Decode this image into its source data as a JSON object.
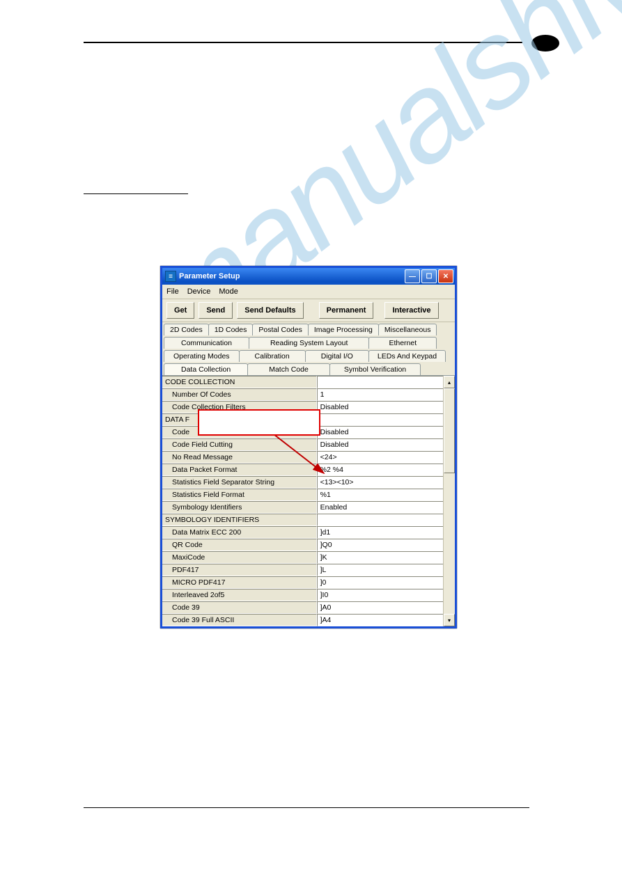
{
  "window": {
    "title": "Parameter Setup",
    "icon_glyph": "≡"
  },
  "menubar": {
    "file": "File",
    "device": "Device",
    "mode": "Mode"
  },
  "toolbar": {
    "get": "Get",
    "send": "Send",
    "send_defaults": "Send Defaults",
    "permanent": "Permanent",
    "interactive": "Interactive"
  },
  "tabs_row1": [
    "2D Codes",
    "1D Codes",
    "Postal Codes",
    "Image Processing",
    "Miscellaneous"
  ],
  "tabs_row2": [
    "Communication",
    "Reading System Layout",
    "Ethernet"
  ],
  "tabs_row3": [
    "Operating Modes",
    "Calibration",
    "Digital I/O",
    "LEDs And Keypad"
  ],
  "tabs_row4": [
    "Data Collection",
    "Match Code",
    "Symbol Verification"
  ],
  "grid": [
    {
      "kind": "header",
      "label": "CODE COLLECTION",
      "value": ""
    },
    {
      "kind": "row",
      "label": "Number Of Codes",
      "value": "1"
    },
    {
      "kind": "row",
      "label": "Code Collection Filters",
      "value": "Disabled"
    },
    {
      "kind": "header",
      "label": "DATA F",
      "value": ""
    },
    {
      "kind": "row",
      "label": "Code",
      "value": "Disabled"
    },
    {
      "kind": "row",
      "label": "Code Field Cutting",
      "value": "Disabled"
    },
    {
      "kind": "row",
      "label": "No Read Message",
      "value": "<24>"
    },
    {
      "kind": "row",
      "label": "Data Packet Format",
      "value": "%2 %4"
    },
    {
      "kind": "row",
      "label": "Statistics Field Separator String",
      "value": "<13><10>"
    },
    {
      "kind": "row",
      "label": "Statistics Field Format",
      "value": "%1"
    },
    {
      "kind": "row",
      "label": "Symbology Identifiers",
      "value": "Enabled"
    },
    {
      "kind": "header",
      "label": "SYMBOLOGY IDENTIFIERS",
      "value": ""
    },
    {
      "kind": "row",
      "label": "Data Matrix ECC 200",
      "value": "]d1"
    },
    {
      "kind": "row",
      "label": "QR Code",
      "value": "]Q0"
    },
    {
      "kind": "row",
      "label": "MaxiCode",
      "value": "]K"
    },
    {
      "kind": "row",
      "label": "PDF417",
      "value": "]L"
    },
    {
      "kind": "row",
      "label": "MICRO PDF417",
      "value": "]0"
    },
    {
      "kind": "row",
      "label": "Interleaved 2of5",
      "value": "]I0"
    },
    {
      "kind": "row",
      "label": "Code 39",
      "value": "]A0"
    },
    {
      "kind": "row",
      "label": "Code 39 Full ASCII",
      "value": "]A4"
    }
  ],
  "watermark_text": "manualshive.com"
}
